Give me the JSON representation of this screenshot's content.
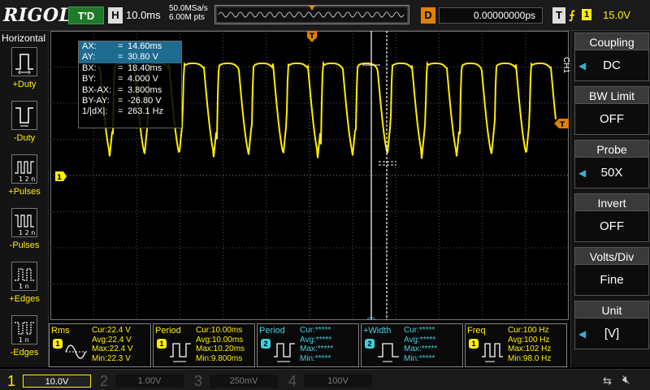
{
  "header": {
    "logo": "RIGOL",
    "run_state": "T'D",
    "timebase_tag": "H",
    "timebase": "10.0ms",
    "sample_rate": "50.0MSa/s",
    "memory_depth": "6.00M pts",
    "delay_tag": "D",
    "delay": "0.00000000ps",
    "trigger_tag": "T",
    "trigger_source": "1",
    "trigger_level": "15.0V"
  },
  "left_menu": {
    "title": "Horizontal",
    "items": [
      {
        "label": "+Duty",
        "icon": "positive-duty-icon"
      },
      {
        "label": "-Duty",
        "icon": "negative-duty-icon"
      },
      {
        "label": "+Pulses",
        "icon": "positive-pulses-icon"
      },
      {
        "label": "-Pulses",
        "icon": "negative-pulses-icon"
      },
      {
        "label": "+Edges",
        "icon": "positive-edges-icon"
      },
      {
        "label": "-Edges",
        "icon": "negative-edges-icon"
      }
    ]
  },
  "cursors": [
    {
      "key": "AX:",
      "value": "14.60ms",
      "selected": true
    },
    {
      "key": "AY:",
      "value": "30.80 V",
      "selected": true
    },
    {
      "key": "BX:",
      "value": "18.40ms",
      "selected": false
    },
    {
      "key": "BY:",
      "value": "4.000 V",
      "selected": false
    },
    {
      "key": "BX-AX:",
      "value": "3.800ms",
      "selected": false
    },
    {
      "key": "BY-AY:",
      "value": "-26.80 V",
      "selected": false
    },
    {
      "key": "1/|dX|:",
      "value": "263.1 Hz",
      "selected": false
    }
  ],
  "right_menu": {
    "channel": "CH1",
    "items": [
      {
        "title": "Coupling",
        "value": "DC",
        "arrow": true
      },
      {
        "title": "BW Limit",
        "value": "OFF",
        "arrow": false
      },
      {
        "title": "Probe",
        "value": "50X",
        "arrow": true
      },
      {
        "title": "Invert",
        "value": "OFF",
        "arrow": false
      },
      {
        "title": "Volts/Div",
        "value": "Fine",
        "arrow": false
      },
      {
        "title": "Unit",
        "value": "[V]",
        "arrow": true
      }
    ]
  },
  "measurements": [
    {
      "name": "Rms",
      "ch": "1",
      "lines": [
        "Cur:22.4 V",
        "Avg:22.4 V",
        "Max:22.4 V",
        "Min:22.3 V"
      ]
    },
    {
      "name": "Period",
      "ch": "1",
      "lines": [
        "Cur:10.00ms",
        "Avg:10.00ms",
        "Max:10.20ms",
        "Min:9.800ms"
      ]
    },
    {
      "name": "Period",
      "ch": "2",
      "lines": [
        "Cur:*****",
        "Avg:*****",
        "Max:*****",
        "Min:*****"
      ]
    },
    {
      "name": "+Width",
      "ch": "2",
      "lines": [
        "Cur:*****",
        "Avg:*****",
        "Max:*****",
        "Min:*****"
      ]
    },
    {
      "name": "Freq",
      "ch": "1",
      "lines": [
        "Cur:100 Hz",
        "Avg:100 Hz",
        "Max:102 Hz",
        "Min:98.0 Hz"
      ]
    }
  ],
  "channels": [
    {
      "num": "1",
      "scale": "10.0V",
      "color": "#ffee00",
      "active": true
    },
    {
      "num": "2",
      "scale": "1.00V",
      "color": "#3fd0e0",
      "active": false
    },
    {
      "num": "3",
      "scale": "250mV",
      "color": "#d040d0",
      "active": false
    },
    {
      "num": "4",
      "scale": "100V",
      "color": "#3070ff",
      "active": false
    }
  ],
  "markers": {
    "ch1_ground": "1",
    "trigger_level": "T",
    "trigger_pos": "T"
  },
  "status_icons": {
    "usb": "usb-icon",
    "sound": "speaker-muted-icon"
  }
}
